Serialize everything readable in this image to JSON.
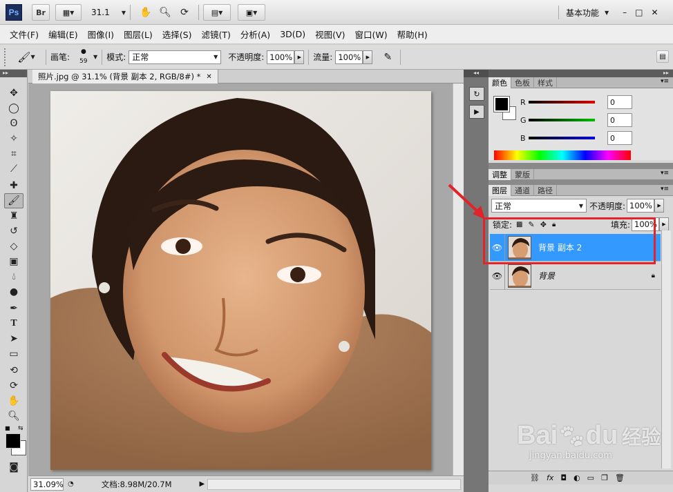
{
  "app": {
    "logo": "Ps",
    "bridge": "Br",
    "zoom": "31.1",
    "workspace": "基本功能",
    "win_controls": [
      "–",
      "□",
      "✕"
    ]
  },
  "menu": [
    "文件(F)",
    "编辑(E)",
    "图像(I)",
    "图层(L)",
    "选择(S)",
    "滤镜(T)",
    "分析(A)",
    "3D(D)",
    "视图(V)",
    "窗口(W)",
    "帮助(H)"
  ],
  "options": {
    "brush_label": "画笔:",
    "brush_size": "59",
    "mode_label": "模式:",
    "mode_value": "正常",
    "opacity_label": "不透明度:",
    "opacity_value": "100%",
    "flow_label": "流量:",
    "flow_value": "100%"
  },
  "document": {
    "tab_title": "照片.jpg @ 31.1% (背景 副本 2, RGB/8#) *",
    "close": "✕",
    "zoom_status": "31.09%",
    "doc_size": "文档:8.98M/20.7M"
  },
  "color_panel": {
    "tabs": [
      "颜色",
      "色板",
      "样式"
    ],
    "channels": [
      {
        "label": "R",
        "value": "0",
        "color": "#e00000"
      },
      {
        "label": "G",
        "value": "0",
        "color": "#00c000"
      },
      {
        "label": "B",
        "value": "0",
        "color": "#0000e0"
      }
    ]
  },
  "adjust_tabs": [
    "调整",
    "蒙版"
  ],
  "layers_panel": {
    "tabs": [
      "图层",
      "通道",
      "路径"
    ],
    "blend_mode": "正常",
    "opacity_label": "不透明度:",
    "opacity_value": "100%",
    "lock_label": "锁定:",
    "fill_label": "填充:",
    "fill_value": "100%",
    "layers": [
      {
        "name": "背景 副本 2",
        "selected": true
      },
      {
        "name": "背景",
        "selected": false
      }
    ]
  },
  "annotation_color": "#e0242a",
  "watermark": {
    "brand": "Bai",
    "brand2": "du",
    "suffix": "经验",
    "url": "jingyan.baidu.com"
  }
}
